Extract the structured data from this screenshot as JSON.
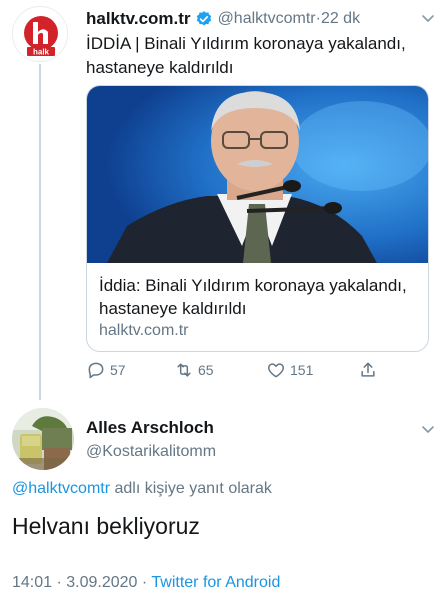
{
  "tweet": {
    "account_name": "halktv.com.tr",
    "handle": "@halktvcomtr",
    "separator": " · ",
    "time": "22 dk",
    "text": "İDDİA | Binali Yıldırım koronaya yakalandı, hastaneye kaldırıldı",
    "avatar_text": "halk",
    "card": {
      "title": "İddia: Binali Yıldırım koronaya yakalandı, hastaneye kaldırıldı",
      "domain": "halktv.com.tr"
    },
    "actions": {
      "replies": "57",
      "retweets": "65",
      "likes": "151"
    }
  },
  "reply": {
    "display_name": "Alles Arschloch",
    "handle": "@Kostarikalitomm",
    "replying_to_handle": "@halktvcomtr",
    "replying_to_suffix": " adlı kişiye yanıt olarak",
    "text": "Helvanı bekliyoruz",
    "time": "14:01",
    "date": "3.09.2020",
    "source": "Twitter for Android",
    "dot": " · "
  },
  "colors": {
    "brand_red": "#d2232a",
    "link_blue": "#1b95e0",
    "muted": "#657786"
  },
  "icons": [
    "verified-badge-icon",
    "chevron-down-icon",
    "reply-icon",
    "retweet-icon",
    "like-icon",
    "share-icon"
  ]
}
